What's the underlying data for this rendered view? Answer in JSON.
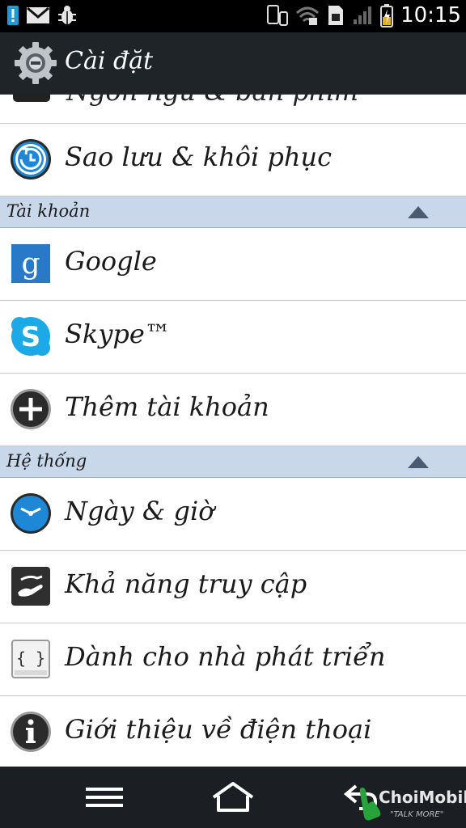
{
  "status_bar": {
    "time": "10:15",
    "left_icons": [
      "alert-icon",
      "gmail-icon",
      "debug-icon"
    ],
    "right_icons": [
      "device-icon",
      "wifi-icon",
      "sim-icon",
      "signal-icon",
      "battery-icon"
    ]
  },
  "action_bar": {
    "title": "Cài đặt",
    "icon": "settings-gear-icon"
  },
  "partial_row": {
    "label": "Ngôn ngữ & bàn phím"
  },
  "sections": [
    {
      "header": null,
      "items": [
        {
          "label": "Sao lưu & khôi phục",
          "icon": "backup-restore-icon"
        }
      ]
    },
    {
      "header": "Tài khoản",
      "items": [
        {
          "label": "Google",
          "icon": "google-icon"
        },
        {
          "label": "Skype™",
          "icon": "skype-icon"
        },
        {
          "label": "Thêm tài khoản",
          "icon": "add-account-icon"
        }
      ]
    },
    {
      "header": "Hệ thống",
      "items": [
        {
          "label": "Ngày & giờ",
          "icon": "clock-icon"
        },
        {
          "label": "Khả năng truy cập",
          "icon": "accessibility-icon"
        },
        {
          "label": "Dành cho nhà phát triển",
          "icon": "developer-icon"
        },
        {
          "label": "Giới thiệu về điện thoại",
          "icon": "info-icon"
        }
      ]
    }
  ],
  "nav_bar": {
    "buttons": [
      "menu-icon",
      "home-icon",
      "back-icon"
    ],
    "watermark_main": "ChoiMobile",
    "watermark_sub": "\"TALK MORE\""
  },
  "colors": {
    "section_header_bg": "#c8d8ea",
    "action_bar_bg": "#1f2429",
    "nav_bar_bg": "#1b1f24"
  }
}
